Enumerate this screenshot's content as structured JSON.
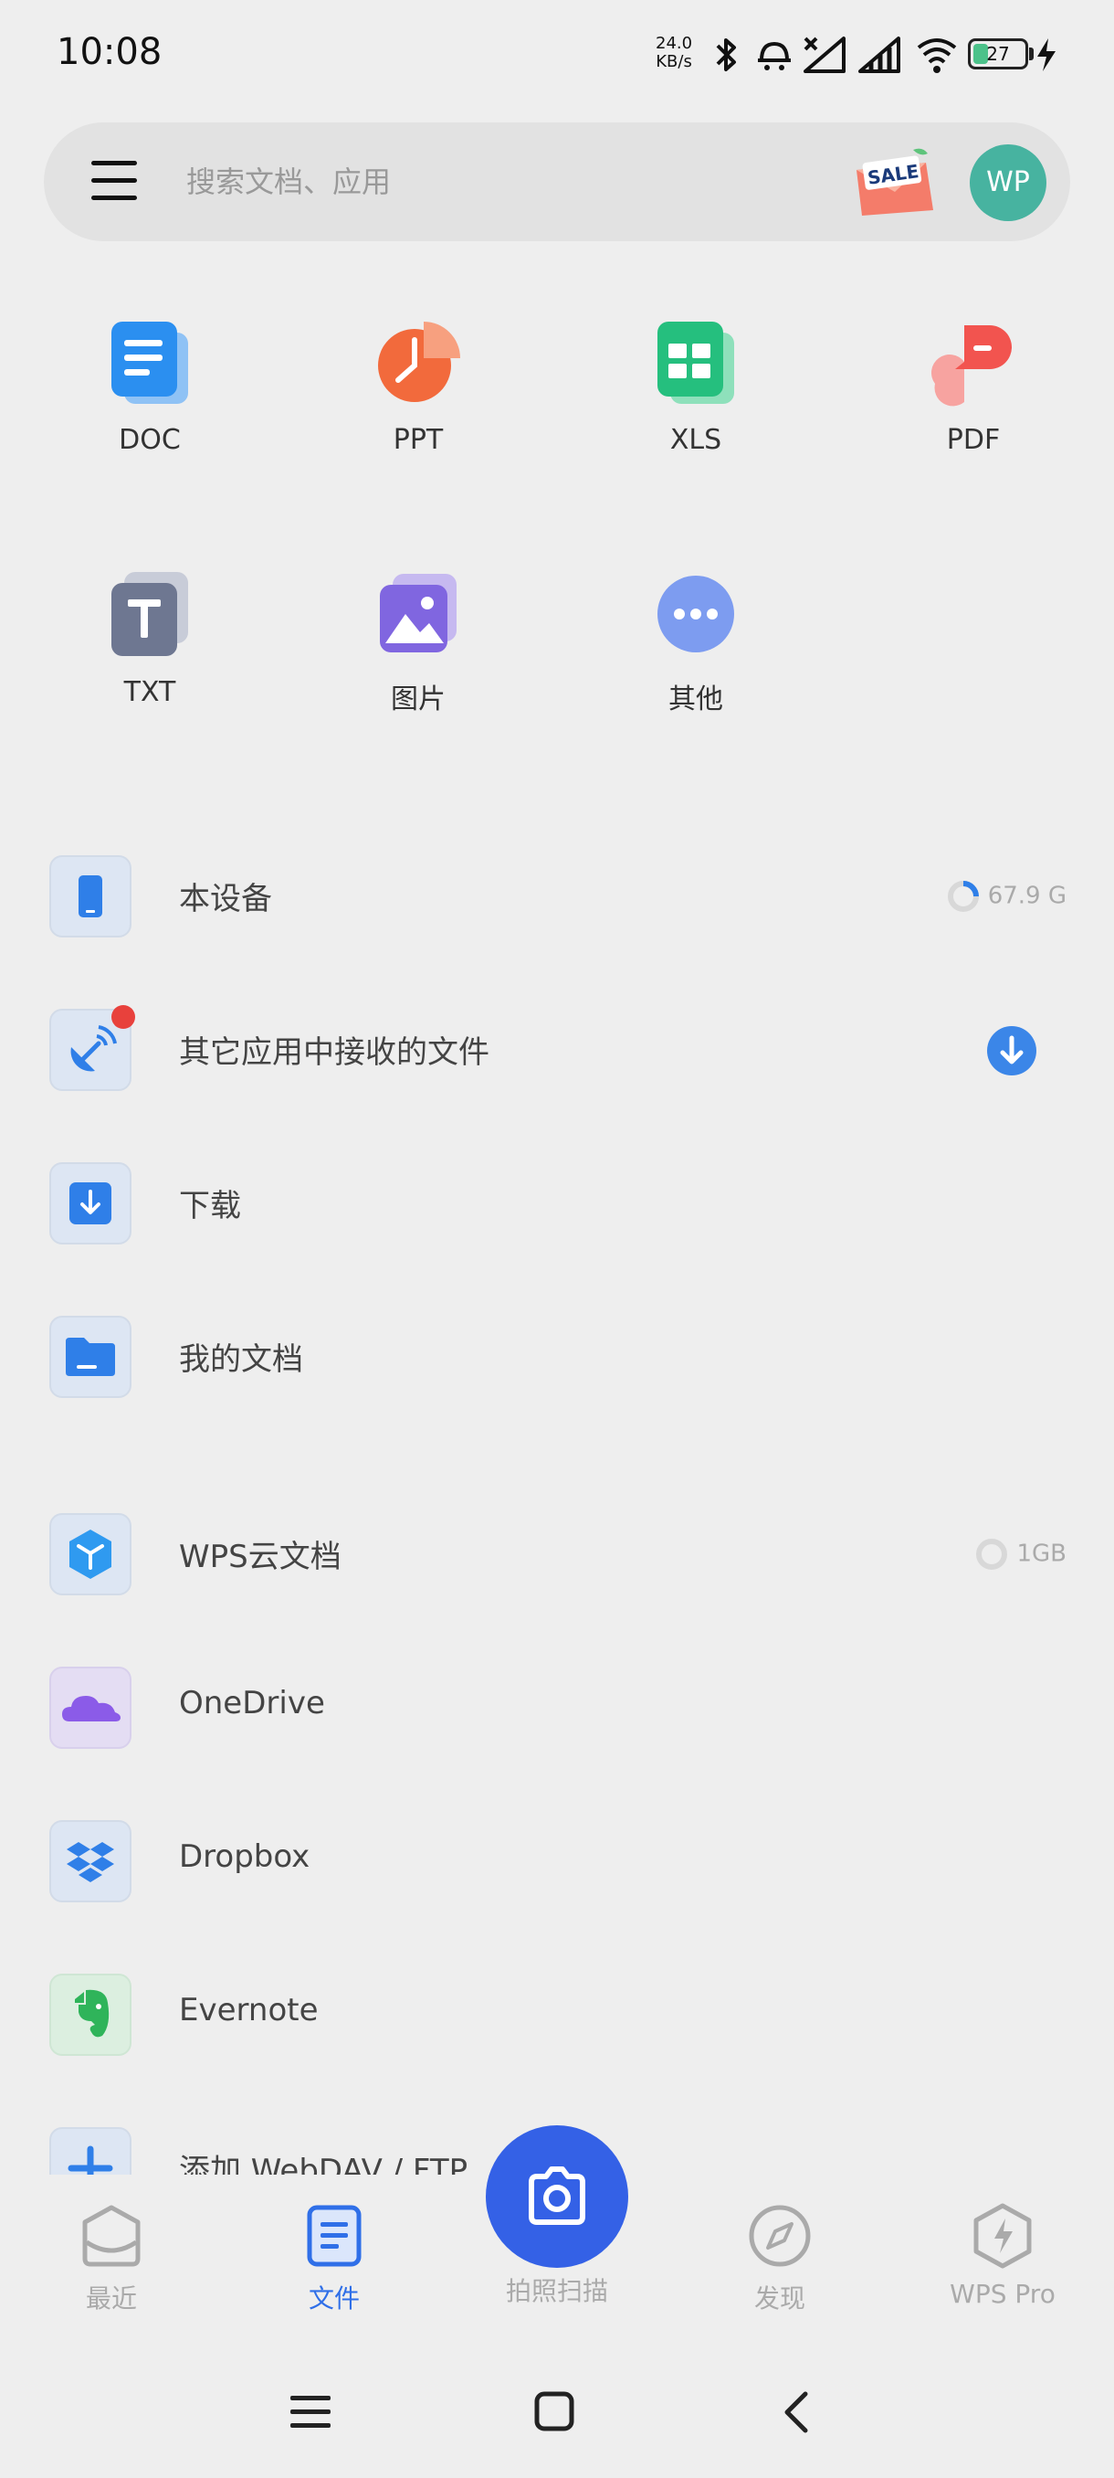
{
  "status_bar": {
    "time": "10:08",
    "speed_value": "24.0",
    "speed_unit": "KB/s",
    "battery": "27"
  },
  "search": {
    "placeholder": "搜索文档、应用",
    "sale_text": "SALE",
    "avatar_text": "WP"
  },
  "categories": [
    {
      "label": "DOC",
      "icon": "doc-icon",
      "color": "#2b8ff0"
    },
    {
      "label": "PPT",
      "icon": "ppt-icon",
      "color": "#f26a3c"
    },
    {
      "label": "XLS",
      "icon": "xls-icon",
      "color": "#25bf7e"
    },
    {
      "label": "PDF",
      "icon": "pdf-icon",
      "color": "#f2544f"
    },
    {
      "label": "TXT",
      "icon": "txt-icon",
      "color": "#6e7791"
    },
    {
      "label": "图片",
      "icon": "image-icon",
      "color": "#8066e0"
    },
    {
      "label": "其他",
      "icon": "more-icon",
      "color": "#6d8ef0"
    }
  ],
  "locations": [
    {
      "label": "本设备",
      "right": "67.9 G",
      "icon": "phone-icon"
    },
    {
      "label": "其它应用中接收的文件",
      "icon": "satellite-icon"
    },
    {
      "label": "下载",
      "icon": "download-icon"
    },
    {
      "label": "我的文档",
      "icon": "folder-icon"
    }
  ],
  "cloud": [
    {
      "label": "WPS云文档",
      "right": "1GB",
      "icon": "wps-cloud-icon"
    },
    {
      "label": "OneDrive",
      "icon": "onedrive-icon"
    },
    {
      "label": "Dropbox",
      "icon": "dropbox-icon"
    },
    {
      "label": "Evernote",
      "icon": "evernote-icon"
    },
    {
      "label": "添加 WebDAV / FTP",
      "icon": "add-icon"
    }
  ],
  "bottom_nav": {
    "recent": "最近",
    "files": "文件",
    "scan": "拍照扫描",
    "discover": "发现",
    "pro": "WPS Pro"
  },
  "colors": {
    "accent": "#3461e6",
    "avatar": "#47b3a0",
    "background": "#eeeeee"
  }
}
